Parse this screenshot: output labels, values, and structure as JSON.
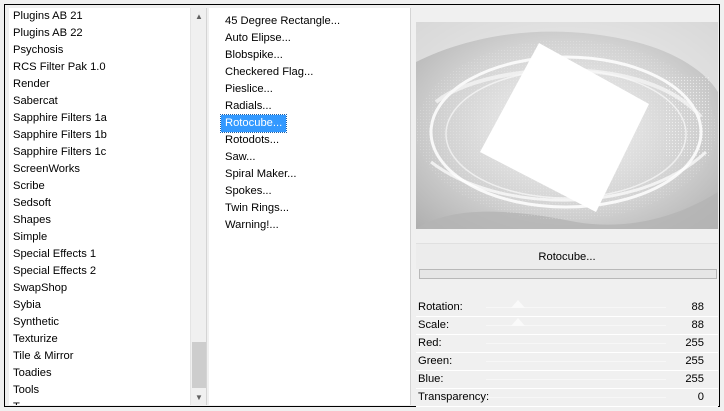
{
  "categories": [
    "Plugins AB 21",
    "Plugins AB 22",
    "Psychosis",
    "RCS Filter Pak 1.0",
    "Render",
    "Sabercat",
    "Sapphire Filters 1a",
    "Sapphire Filters 1b",
    "Sapphire Filters 1c",
    "ScreenWorks",
    "Scribe",
    "Sedsoft",
    "Shapes",
    "Simple",
    "Special Effects 1",
    "Special Effects 2",
    "SwapShop",
    "Sybia",
    "Synthetic",
    "Texturize",
    "Tile & Mirror",
    "Toadies",
    "Tools",
    "T..."
  ],
  "filters": [
    "45 Degree Rectangle...",
    "Auto Elipse...",
    "Blobspike...",
    "Checkered Flag...",
    "Pieslice...",
    "Radials...",
    "Rotocube...",
    "Rotodots...",
    "Saw...",
    "Spiral Maker...",
    "Spokes...",
    "Twin Rings...",
    "Warning!..."
  ],
  "selected_filter": "Rotocube...",
  "preview": {
    "apply_button_label": "Rotocube..."
  },
  "params": [
    {
      "label": "Rotation:",
      "value": "88"
    },
    {
      "label": "Scale:",
      "value": "88"
    },
    {
      "label": "Red:",
      "value": "255"
    },
    {
      "label": "Green:",
      "value": "255"
    },
    {
      "label": "Blue:",
      "value": "255"
    },
    {
      "label": "Transparency:",
      "value": "0"
    }
  ],
  "colors": {
    "selection": "#3399ff",
    "pane_background": "#ffffff",
    "window_background": "#f0f0f0"
  }
}
